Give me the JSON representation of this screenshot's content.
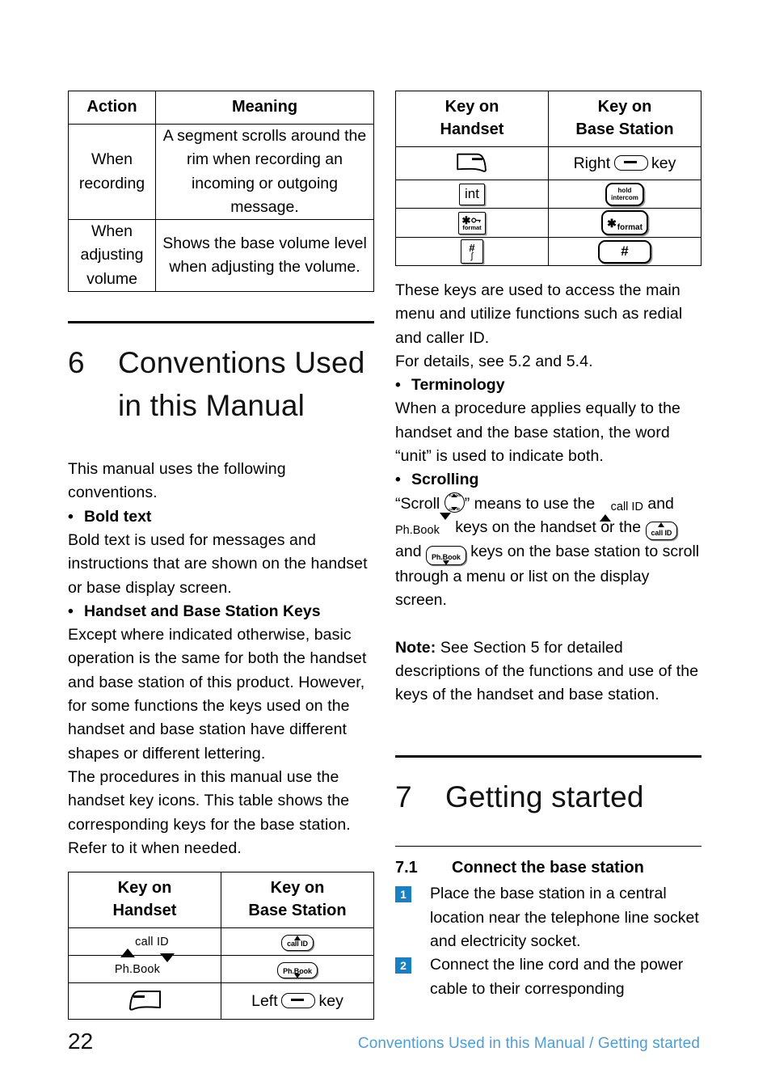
{
  "page": {
    "number": "22",
    "footer_breadcrumb": "Conventions Used in this Manual / Getting started",
    "accent_color": "#1a80c4",
    "footer_color": "#4a9fd8"
  },
  "left_column": {
    "action_table": {
      "headers": [
        "Action",
        "Meaning"
      ],
      "rows": [
        {
          "action": "When recording",
          "meaning": "A segment scrolls around the rim when recording an incoming or outgoing message."
        },
        {
          "action": "When adjusting volume",
          "meaning": "Shows the base volume level when adjusting the volume."
        }
      ]
    },
    "section": {
      "number": "6",
      "title_line1": "Conventions Used",
      "title_line2": "in this Manual"
    },
    "intro": "This manual uses the following conventions.",
    "bullets": [
      {
        "bullet": "•",
        "title": "Bold text",
        "body": "Bold text is used for messages and instructions that are shown on the handset or base display screen."
      },
      {
        "bullet": "•",
        "title": "Handset and Base Station Keys",
        "body": "Except where indicated otherwise, basic operation is the same for both the handset and base station of this product. However, for some functions the keys used on the handset and base station have different shapes or different lettering.",
        "body2": "The procedures in this manual use the handset key icons. This table shows the corresponding keys for the base station. Refer to it when needed."
      }
    ],
    "key_table": {
      "headers": [
        "Key on Handset",
        "Key on Base Station"
      ],
      "header_line1": "Key on",
      "header_handset": "Handset",
      "header_base": "Base Station",
      "rows": [
        {
          "handset_icon": "call-id-up-key-icon",
          "handset_label": "call ID",
          "base_icon": "call-id-base-key-icon",
          "base_label": "call ID"
        },
        {
          "handset_icon": "phbook-down-key-icon",
          "handset_label": "Ph.Book",
          "base_icon": "phbook-base-key-icon",
          "base_label": "Ph.Book"
        },
        {
          "handset_icon": "soft-key-icon",
          "handset_label": "",
          "base_text_prefix": "Left",
          "base_icon": "oval-dash-key-icon",
          "base_text_suffix": "key"
        }
      ]
    }
  },
  "right_column": {
    "key_table": {
      "header_line1": "Key on",
      "header_handset": "Handset",
      "header_base": "Base Station",
      "rows": [
        {
          "handset_icon": "soft-key-icon",
          "base_text_prefix": "Right",
          "base_icon": "oval-dash-key-icon",
          "base_text_suffix": "key"
        },
        {
          "handset_icon": "int-key-icon",
          "handset_label": "int",
          "base_icon": "hold-intercom-key-icon",
          "base_label_1": "hold",
          "base_label_2": "intercom"
        },
        {
          "handset_icon": "star-format-key-icon",
          "handset_label": "format",
          "base_icon": "star-format-base-key-icon",
          "base_label": "format"
        },
        {
          "handset_icon": "hash-key-icon",
          "handset_label": "#",
          "base_icon": "hash-base-key-icon",
          "base_label": "#"
        }
      ]
    },
    "para1": "These keys are used to access the main menu and utilize functions such as redial and caller ID.",
    "para2": "For details, see 5.2 and 5.4.",
    "terminology": {
      "bullet": "•",
      "title": "Terminology",
      "body": "When a procedure applies equally to the handset and the base station, the word “unit” is used to indicate both."
    },
    "scrolling": {
      "bullet": "•",
      "title": "Scrolling",
      "text_1": "“Scroll",
      "text_2": "” means to use the",
      "text_3": "and",
      "text_4": "keys on the handset or the",
      "text_5": "and",
      "text_6": "keys on the base station to scroll through a menu or list on the display screen.",
      "icon_scroll": "round-scroll-key-icon",
      "icon_callid": "call-id-up-key-icon",
      "icon_phbook": "phbook-down-key-icon",
      "icon_callid_base": "call-id-base-key-icon",
      "icon_phbook_base": "phbook-base-key-icon",
      "label_callid": "call ID",
      "label_phbook": "Ph.Book"
    },
    "note": {
      "label": "Note:",
      "body": " See Section 5 for detailed descriptions of the functions and use of the keys of the handset and base station."
    },
    "section": {
      "number": "7",
      "title": "Getting started"
    },
    "subsection": {
      "number": "7.1",
      "title": "Connect the base station"
    },
    "steps": [
      {
        "badge": "1",
        "text": "Place the base station in a central location near the telephone line socket and electricity socket."
      },
      {
        "badge": "2",
        "text": "Connect the line cord and the power cable to their corresponding"
      }
    ]
  }
}
